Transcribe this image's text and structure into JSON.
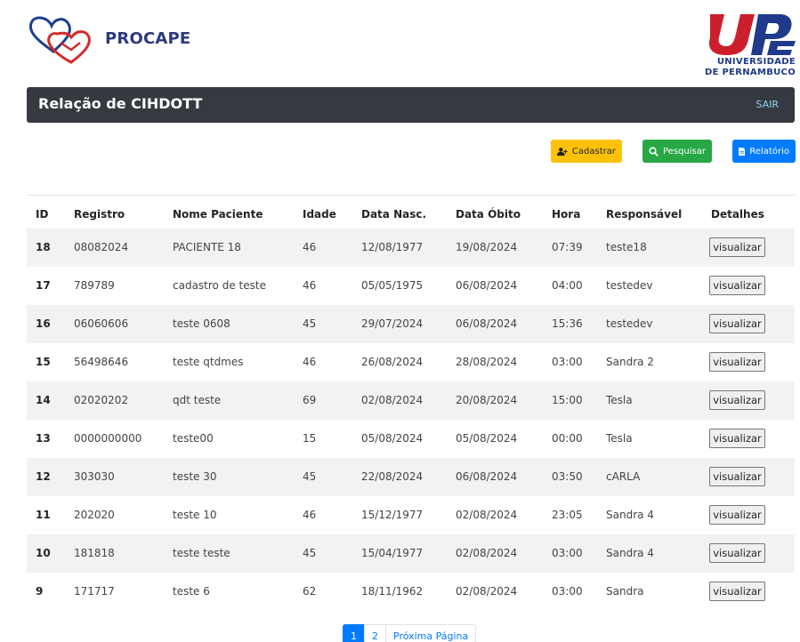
{
  "brand": {
    "name": "PROCAPE"
  },
  "university": {
    "big": "UPE",
    "line1": "UNIVERSIDADE",
    "line2": "DE PERNAMBUCO"
  },
  "titlebar": {
    "title": "Relação de CIHDOTT",
    "logout": "SAIR"
  },
  "actions": {
    "cadastrar": "Cadastrar",
    "pesquisar": "Pesquisar",
    "relatorio": "Relatório"
  },
  "colors": {
    "dark": "#343a40",
    "warning": "#ffc107",
    "success": "#28a745",
    "primary": "#007bff"
  },
  "table": {
    "headers": [
      "ID",
      "Registro",
      "Nome Paciente",
      "Idade",
      "Data Nasc.",
      "Data Óbito",
      "Hora",
      "Responsável",
      "Detalhes"
    ],
    "rows": [
      {
        "id": "18",
        "registro": "08082024",
        "nome": "PACIENTE 18",
        "idade": "46",
        "nasc": "12/08/1977",
        "obito": "19/08/2024",
        "hora": "07:39",
        "resp": "teste18",
        "btn": "visualizar"
      },
      {
        "id": "17",
        "registro": "789789",
        "nome": "cadastro de teste",
        "idade": "46",
        "nasc": "05/05/1975",
        "obito": "06/08/2024",
        "hora": "04:00",
        "resp": "testedev",
        "btn": "visualizar"
      },
      {
        "id": "16",
        "registro": "06060606",
        "nome": "teste 0608",
        "idade": "45",
        "nasc": "29/07/2024",
        "obito": "06/08/2024",
        "hora": "15:36",
        "resp": "testedev",
        "btn": "visualizar"
      },
      {
        "id": "15",
        "registro": "56498646",
        "nome": "teste qtdmes",
        "idade": "46",
        "nasc": "26/08/2024",
        "obito": "28/08/2024",
        "hora": "03:00",
        "resp": "Sandra 2",
        "btn": "visualizar"
      },
      {
        "id": "14",
        "registro": "02020202",
        "nome": "qdt teste",
        "idade": "69",
        "nasc": "02/08/2024",
        "obito": "20/08/2024",
        "hora": "15:00",
        "resp": "Tesla",
        "btn": "visualizar"
      },
      {
        "id": "13",
        "registro": "0000000000",
        "nome": "teste00",
        "idade": "15",
        "nasc": "05/08/2024",
        "obito": "05/08/2024",
        "hora": "00:00",
        "resp": "Tesla",
        "btn": "visualizar"
      },
      {
        "id": "12",
        "registro": "303030",
        "nome": "teste 30",
        "idade": "45",
        "nasc": "22/08/2024",
        "obito": "06/08/2024",
        "hora": "03:50",
        "resp": "cARLA",
        "btn": "visualizar"
      },
      {
        "id": "11",
        "registro": "202020",
        "nome": "teste 10",
        "idade": "46",
        "nasc": "15/12/1977",
        "obito": "02/08/2024",
        "hora": "23:05",
        "resp": "Sandra 4",
        "btn": "visualizar"
      },
      {
        "id": "10",
        "registro": "181818",
        "nome": "teste teste",
        "idade": "45",
        "nasc": "15/04/1977",
        "obito": "02/08/2024",
        "hora": "03:00",
        "resp": "Sandra 4",
        "btn": "visualizar"
      },
      {
        "id": "9",
        "registro": "171717",
        "nome": "teste 6",
        "idade": "62",
        "nasc": "18/11/1962",
        "obito": "02/08/2024",
        "hora": "03:00",
        "resp": "Sandra",
        "btn": "visualizar"
      }
    ]
  },
  "pagination": {
    "pages": [
      "1",
      "2"
    ],
    "next": "Próxima Página",
    "current": "1"
  }
}
